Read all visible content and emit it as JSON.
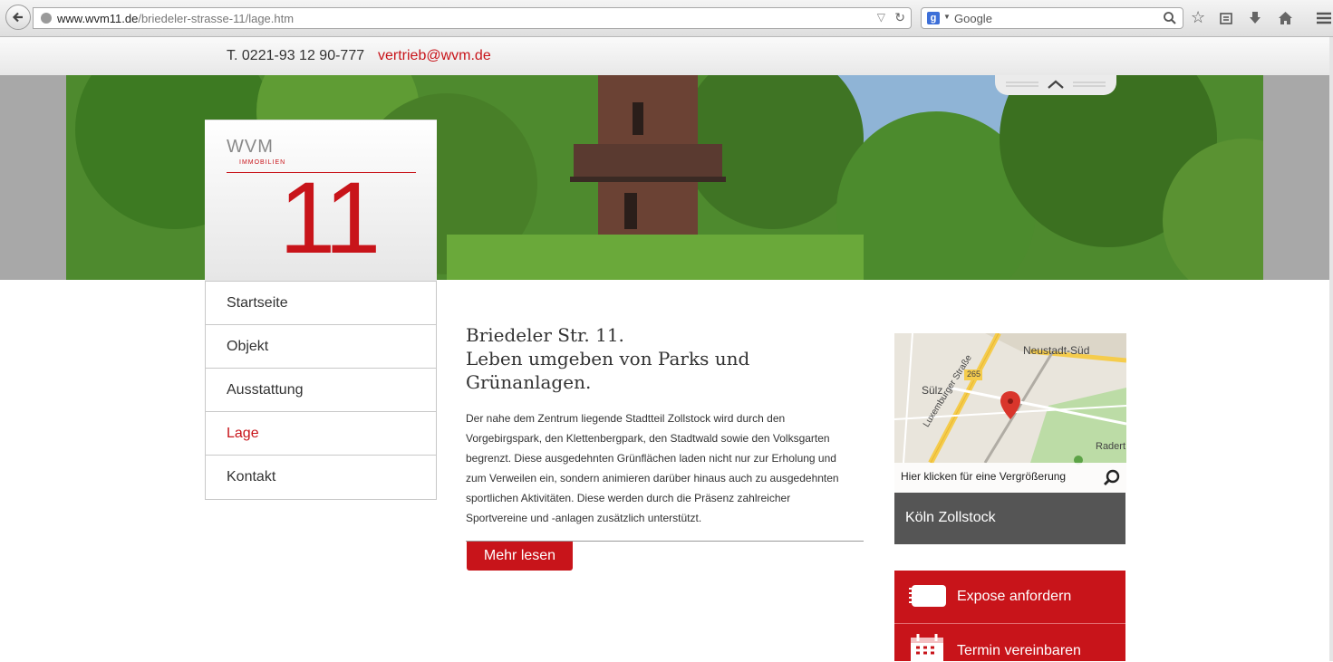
{
  "browser": {
    "url_host": "www.wvm11.de",
    "url_path": "/briedeler-strasse-11/lage.htm",
    "search_placeholder": "Google"
  },
  "topbar": {
    "phone": "T. 0221-93 12 90-777",
    "email": "vertrieb@wvm.de"
  },
  "logo": {
    "brand": "WVM",
    "sub": "IMMOBILIEN",
    "number": "11"
  },
  "nav": {
    "items": [
      {
        "label": "Startseite"
      },
      {
        "label": "Objekt"
      },
      {
        "label": "Ausstattung"
      },
      {
        "label": "Lage"
      },
      {
        "label": "Kontakt"
      }
    ],
    "active": "Lage"
  },
  "main": {
    "title_lines": [
      "Briedeler Str. 11.",
      "Leben umgeben von Parks und",
      "Grünanlagen."
    ],
    "body_lines": [
      "Der nahe dem Zentrum liegende Stadtteil Zollstock wird durch den",
      "Vorgebirgspark, den Klettenbergpark, den Stadtwald sowie den Volksgarten",
      "begrenzt. Diese ausgedehnten Grünflächen laden nicht nur zur Erholung und",
      "zum Verweilen ein, sondern animieren darüber hinaus auch zu ausgedehnten",
      "sportlichen Aktivitäten. Diese werden durch die Präsenz zahlreicher",
      "Sportvereine und -anlagen zusätzlich unterstützt."
    ],
    "more_button": "Mehr lesen"
  },
  "map": {
    "labels": {
      "neustadt": "Neustadt-Süd",
      "suelz": "Sülz",
      "road": "265",
      "street": "Luxemburger Straße",
      "radert": "Radert"
    },
    "caption": "Hier klicken für eine Vergrößerung",
    "location": "Köln Zollstock"
  },
  "cta": {
    "expose": "Expose anfordern",
    "termin": "Termin vereinbaren"
  },
  "colors": {
    "accent": "#c8141a",
    "dark_box": "#555555"
  }
}
